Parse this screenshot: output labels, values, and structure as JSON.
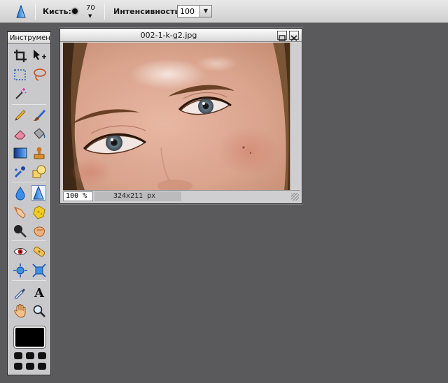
{
  "options_bar": {
    "active_tool_icon": "sharpen-tool-icon",
    "brush_label": "Кисть:",
    "brush_size": "70",
    "intensity_label": "Интенсивность:",
    "intensity_value": "100"
  },
  "tools_panel": {
    "title": "Инструмен",
    "active_tool": "sharpen",
    "foreground_color": "#000000",
    "tools": [
      "crop-icon",
      "move-icon",
      "rect-select-icon",
      "lasso-icon",
      "magic-wand-icon",
      "pencil-icon",
      "brush-icon",
      "eraser-icon",
      "paint-bucket-icon",
      "gradient-icon",
      "clone-stamp-icon",
      "color-replace-icon",
      "shape-icon",
      "blur-icon",
      "sharpen-icon",
      "smudge-icon",
      "sponge-icon",
      "dodge-icon",
      "burn-icon",
      "red-eye-icon",
      "spot-heal-icon",
      "bloat-icon",
      "pinch-icon",
      "color-picker-icon",
      "type-icon",
      "hand-icon",
      "zoom-icon"
    ]
  },
  "image_window": {
    "title": "002-1-k-g2.jpg",
    "zoom": "100 %",
    "dimensions": "324x211 px"
  },
  "colors": {
    "workspace": "#5a5a5c",
    "panel": "#c9c9cb"
  }
}
